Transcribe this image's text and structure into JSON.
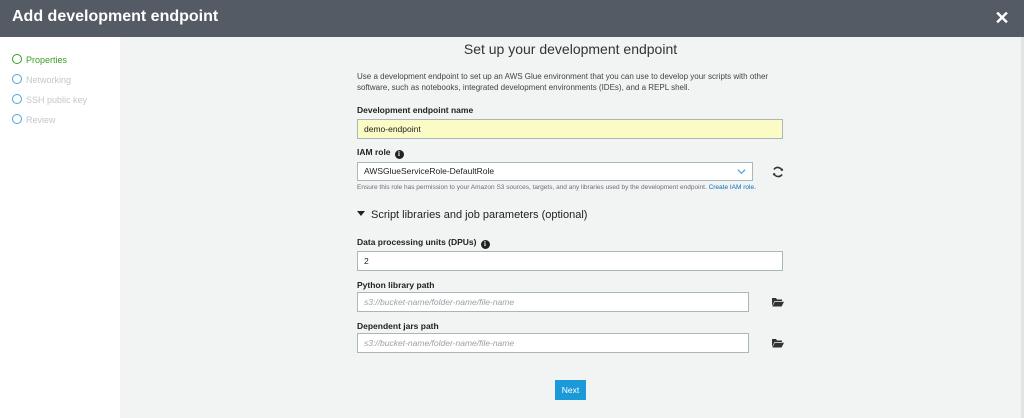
{
  "window": {
    "title": "Add development endpoint",
    "close_icon": "close-icon"
  },
  "sidebar": {
    "steps": [
      {
        "label": "Properties",
        "active": true
      },
      {
        "label": "Networking",
        "active": false
      },
      {
        "label": "SSH public key",
        "active": false
      },
      {
        "label": "Review",
        "active": false
      }
    ]
  },
  "main": {
    "heading": "Set up your development endpoint",
    "description": "Use a development endpoint to set up an AWS Glue environment that you can use to develop your scripts with other software, such as notebooks, integrated development environments (IDEs), and a REPL shell.",
    "endpoint_name": {
      "label": "Development endpoint name",
      "value": "demo-endpoint"
    },
    "iam_role": {
      "label": "IAM role",
      "selected": "AWSGlueServiceRole-DefaultRole",
      "help_text": "Ensure this role has permission to your Amazon S3 sources, targets, and any libraries used by the development endpoint.",
      "help_link": "Create IAM role."
    },
    "expander_label": "Script libraries and job parameters (optional)",
    "dpus": {
      "label": "Data processing units (DPUs)",
      "value": "2"
    },
    "python_path": {
      "label": "Python library path",
      "placeholder": "s3://bucket-name/folder-name/file-name"
    },
    "jars_path": {
      "label": "Dependent jars path",
      "placeholder": "s3://bucket-name/folder-name/file-name"
    },
    "next_label": "Next"
  },
  "colors": {
    "header": "#545b64",
    "accent": "#1a9ad8",
    "active_step": "#3a9d23",
    "highlight": "#fafbc5"
  }
}
